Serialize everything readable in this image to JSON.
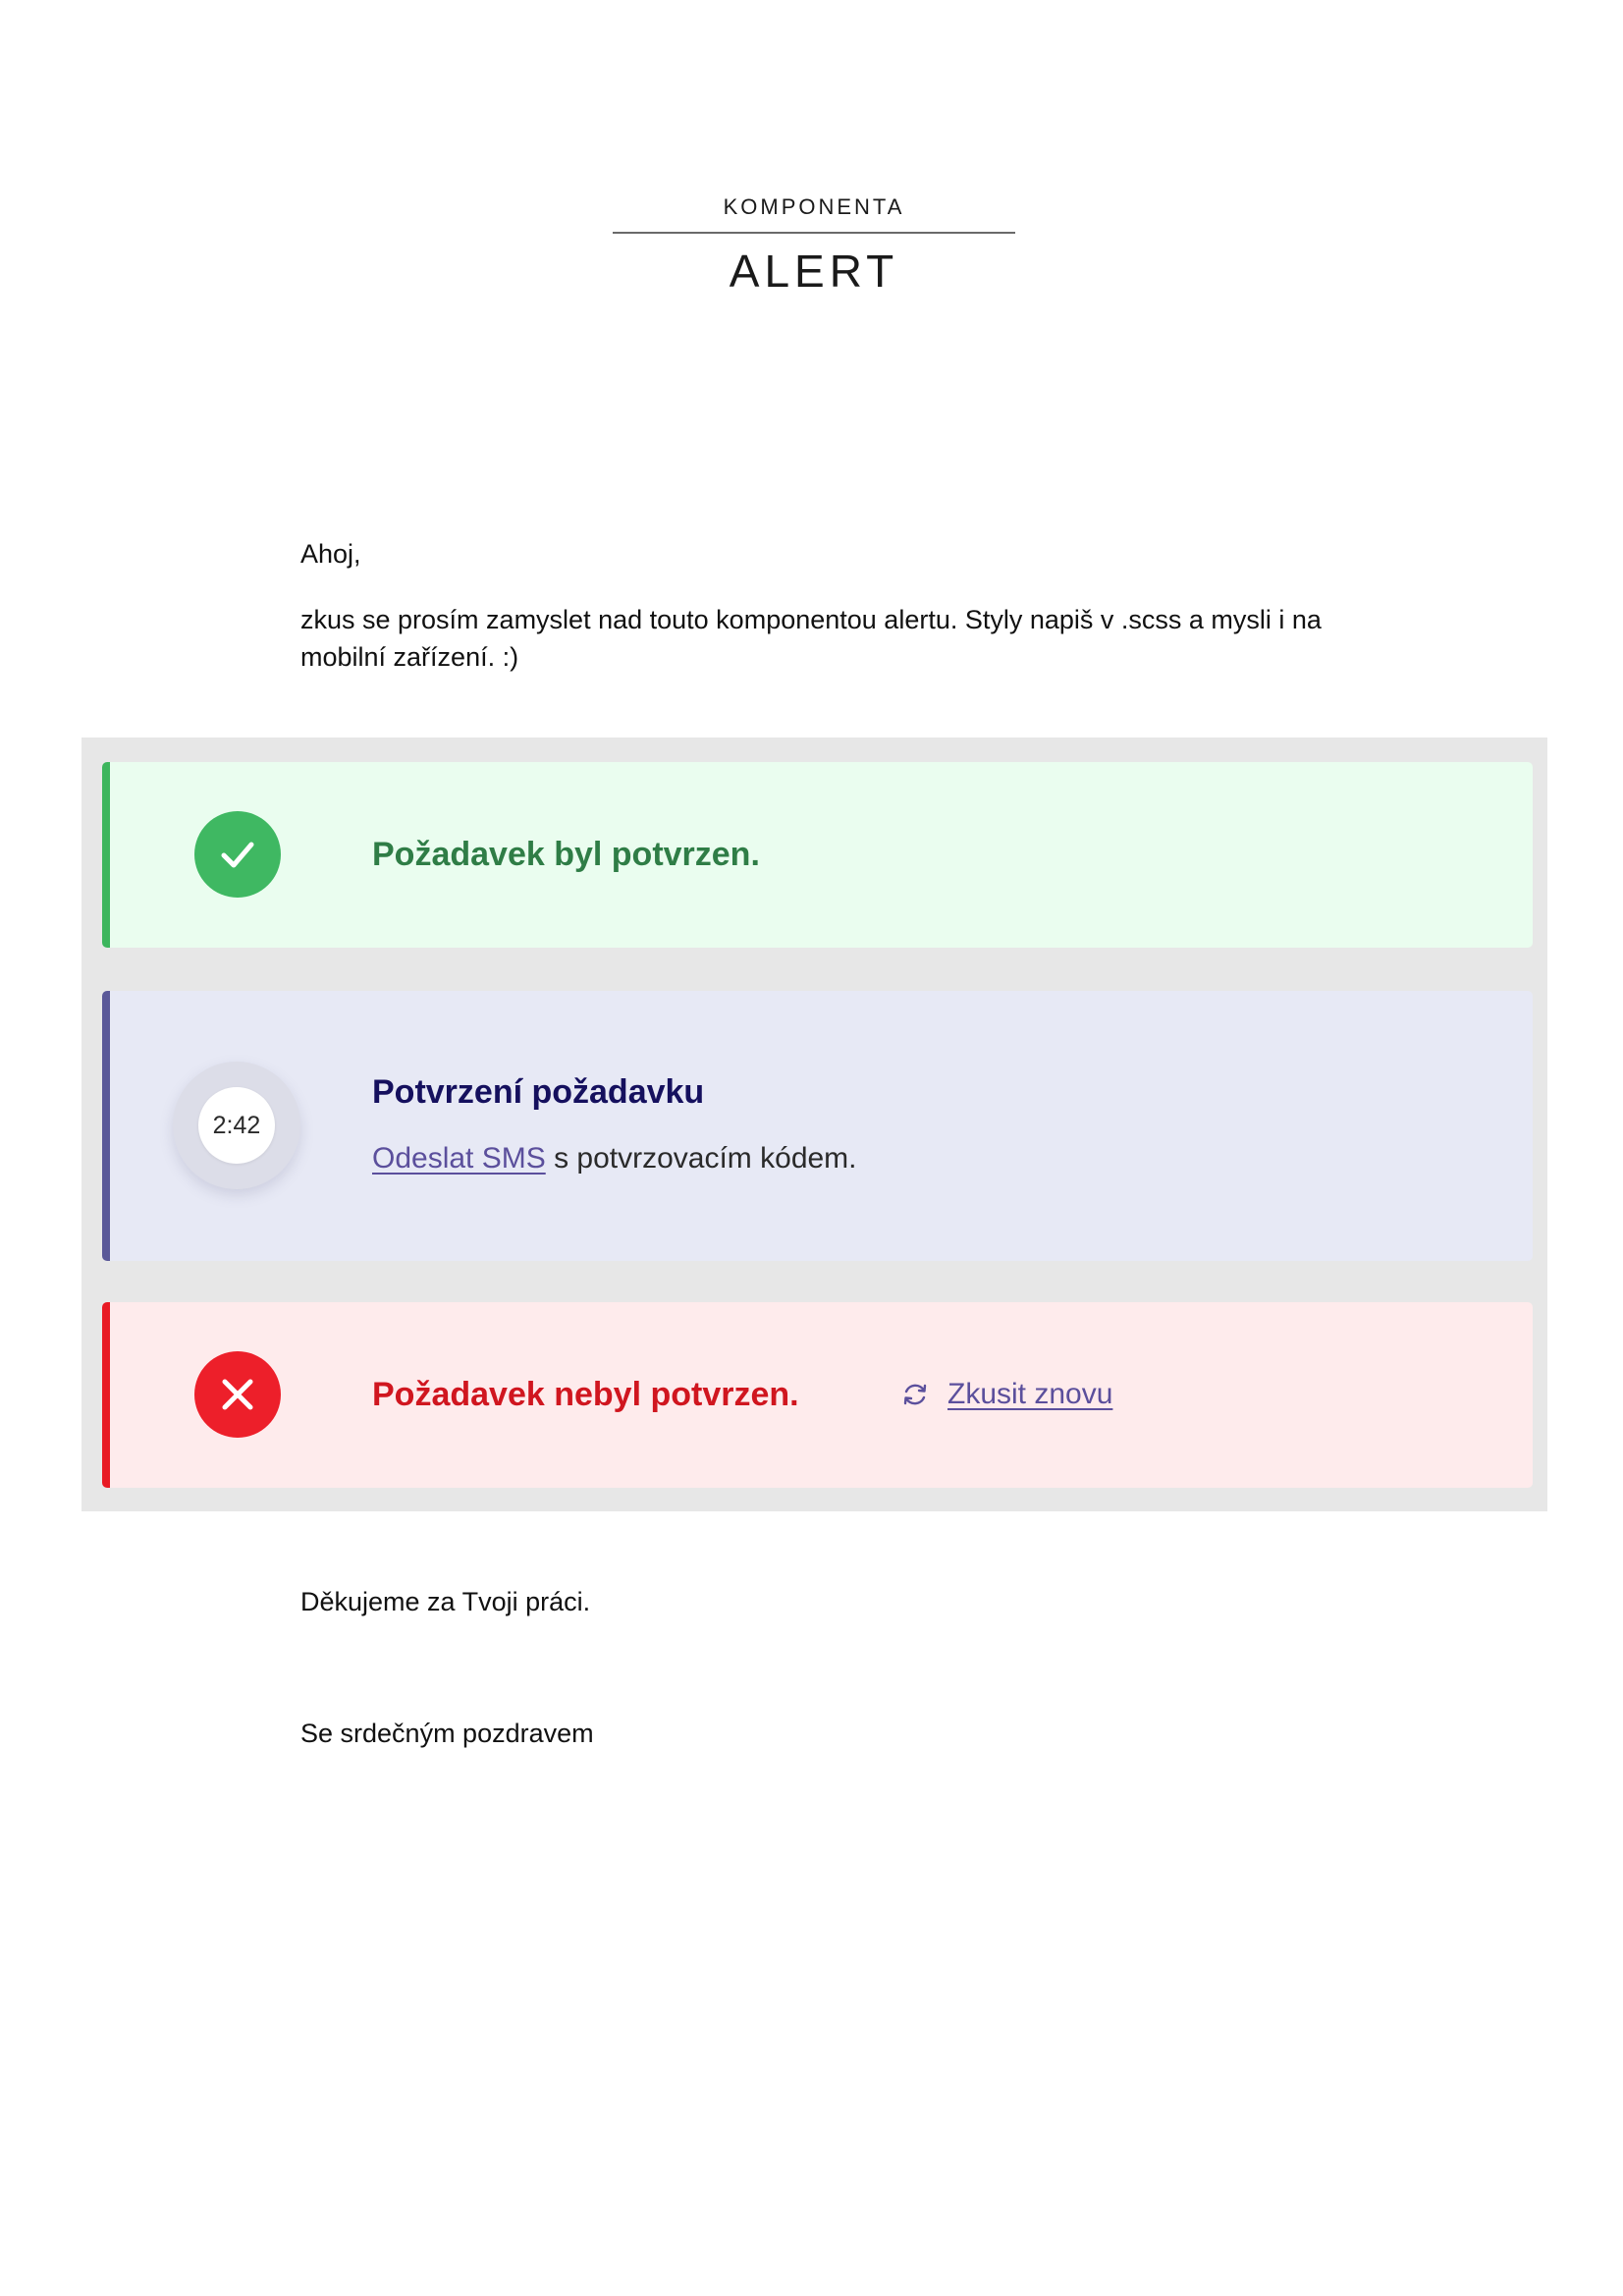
{
  "header": {
    "kicker": "KOMPONENTA",
    "title": "ALERT"
  },
  "letter": {
    "greeting": "Ahoj,",
    "intro": "zkus se prosím zamyslet nad touto komponentou alertu. Styly napiš v .scss a mysli i na mobilní zařízení. :)",
    "thanks": "Děkujeme za Tvoji práci.",
    "regards": "Se srdečným pozdravem"
  },
  "alerts": {
    "success": {
      "title": "Požadavek byl potvrzen.",
      "icon": "check-icon",
      "accent_color": "#3db55d"
    },
    "info": {
      "title": "Potvrzení požadavku",
      "timer": "2:42",
      "link_label": "Odeslat SMS",
      "description_rest": " s potvrzovacím kódem.",
      "icon": "timer-icon",
      "accent_color": "#5a5898"
    },
    "error": {
      "title": "Požadavek nebyl potvrzen.",
      "retry_label": "Zkusit znovu",
      "icon": "close-icon",
      "retry_icon": "refresh-icon",
      "accent_color": "#e81a24"
    }
  }
}
